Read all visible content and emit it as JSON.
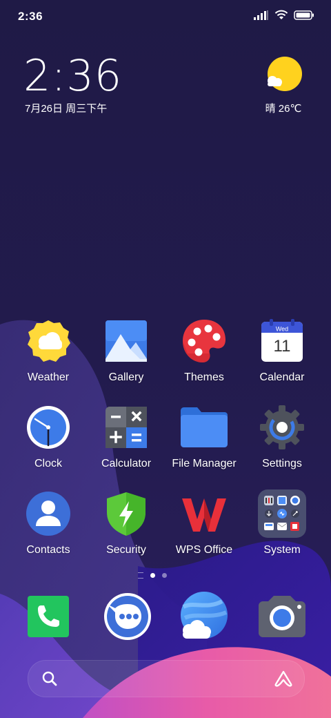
{
  "status_bar": {
    "time": "2:36",
    "icons": [
      "signal-icon",
      "wifi-icon",
      "battery-icon"
    ]
  },
  "clock_widget": {
    "time": "2:36",
    "date": "7月26日 周三下午"
  },
  "weather_widget": {
    "icon": "sunny-cloud-icon",
    "text": "晴 26℃"
  },
  "apps": [
    {
      "label": "Weather",
      "icon": "weather-icon"
    },
    {
      "label": "Gallery",
      "icon": "gallery-icon"
    },
    {
      "label": "Themes",
      "icon": "palette-icon"
    },
    {
      "label": "Calendar",
      "icon": "calendar-icon",
      "calendar_month": "Wed",
      "calendar_day": "11"
    },
    {
      "label": "Clock",
      "icon": "clock-icon"
    },
    {
      "label": "Calculator",
      "icon": "calculator-icon"
    },
    {
      "label": "File Manager",
      "icon": "folder-icon"
    },
    {
      "label": "Settings",
      "icon": "gear-icon"
    },
    {
      "label": "Contacts",
      "icon": "contacts-icon"
    },
    {
      "label": "Security",
      "icon": "shield-icon"
    },
    {
      "label": "WPS Office",
      "icon": "wps-icon"
    },
    {
      "label": "System",
      "icon": "system-folder-icon"
    }
  ],
  "pager": {
    "pages": 3,
    "current": 1
  },
  "dock": [
    {
      "icon": "phone-icon"
    },
    {
      "icon": "messages-icon"
    },
    {
      "icon": "browser-icon"
    },
    {
      "icon": "camera-icon"
    }
  ],
  "search_bar": {
    "left_icon": "search-icon",
    "right_icon": "assistant-icon"
  },
  "colors": {
    "background": "#211b4a",
    "accent_sun": "#FFD21E",
    "wave_pink": "#E84F9C"
  }
}
